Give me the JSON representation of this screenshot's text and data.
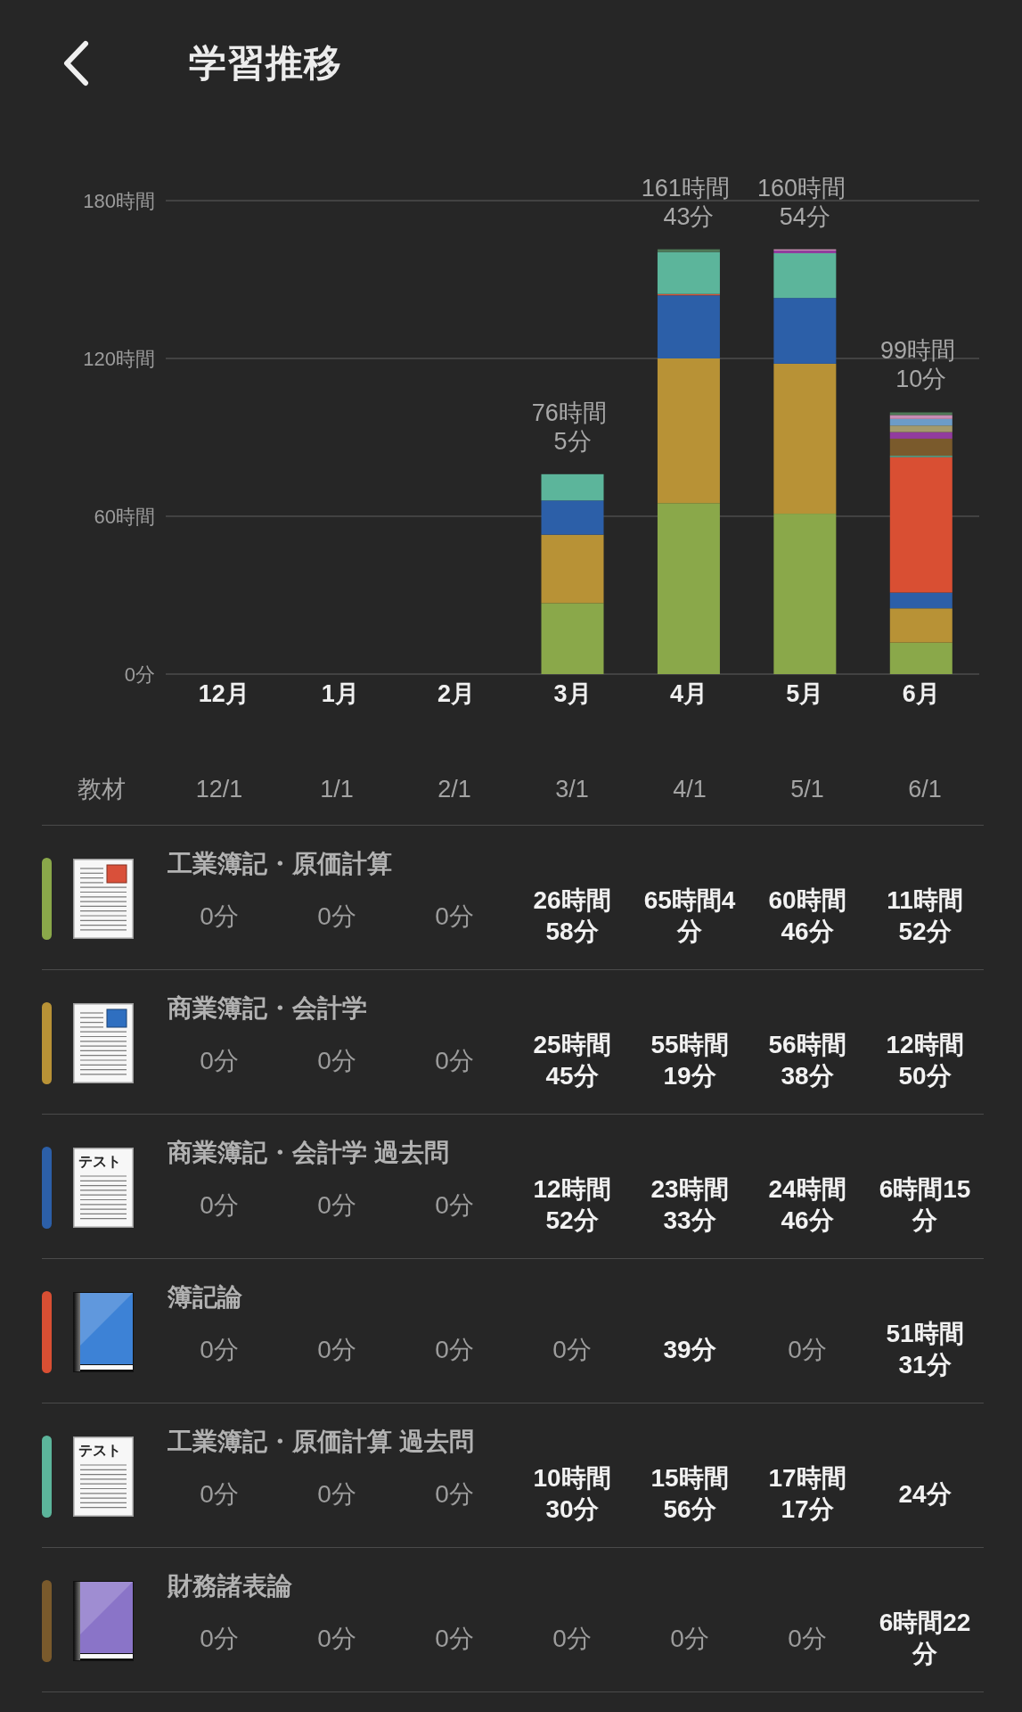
{
  "header": {
    "title": "学習推移"
  },
  "chart": {
    "chart_data": {
      "type": "bar",
      "stacked": true,
      "categories": [
        "12月",
        "1月",
        "2月",
        "3月",
        "4月",
        "5月",
        "6月"
      ],
      "ylim": [
        0,
        180
      ],
      "yticks": [
        {
          "value": 0,
          "label": "0分"
        },
        {
          "value": 60,
          "label": "60時間"
        },
        {
          "value": 120,
          "label": "120時間"
        },
        {
          "value": 180,
          "label": "180時間"
        }
      ],
      "series": [
        {
          "color": "#8aa84a",
          "values": [
            0,
            0,
            0,
            27,
            65,
            61,
            12
          ]
        },
        {
          "color": "#b89236",
          "values": [
            0,
            0,
            0,
            26,
            55,
            57,
            13
          ]
        },
        {
          "color": "#2c5fa8",
          "values": [
            0,
            0,
            0,
            13,
            24,
            25,
            6
          ]
        },
        {
          "color": "#d94f33",
          "values": [
            0,
            0,
            0,
            0,
            0.5,
            0,
            51.5
          ]
        },
        {
          "color": "#5cb59b",
          "values": [
            0,
            0,
            0,
            10,
            16,
            17,
            0.5
          ]
        },
        {
          "color": "#7a5a2c",
          "values": [
            0,
            0,
            0,
            0,
            0,
            0,
            6.5
          ]
        },
        {
          "color": "#923c9e",
          "values": [
            0,
            0,
            0,
            0,
            0,
            1,
            2.5
          ]
        },
        {
          "color": "#a39a6c",
          "values": [
            0,
            0,
            0,
            0,
            0,
            0,
            2.5
          ]
        },
        {
          "color": "#6c9cc8",
          "values": [
            0,
            0,
            0,
            0,
            0,
            0,
            2.5
          ]
        },
        {
          "color": "#c88db4",
          "values": [
            0,
            0,
            0,
            0,
            0,
            0.5,
            1.5
          ]
        },
        {
          "color": "#4f7a58",
          "values": [
            0,
            0,
            0,
            0,
            1,
            0,
            1
          ]
        }
      ],
      "value_labels": [
        null,
        null,
        null,
        "76時間\n5分",
        "161時間\n43分",
        "160時間\n54分",
        "99時間\n10分"
      ]
    }
  },
  "table": {
    "columns": [
      "教材",
      "12/1",
      "1/1",
      "2/1",
      "3/1",
      "4/1",
      "5/1",
      "6/1"
    ],
    "rows": [
      {
        "color": "#8aa84a",
        "icon": {
          "kind": "document",
          "color": "#d9503a"
        },
        "title": "工業簿記・原価計算",
        "values": [
          {
            "text": "0分",
            "emphasized": false
          },
          {
            "text": "0分",
            "emphasized": false
          },
          {
            "text": "0分",
            "emphasized": false
          },
          {
            "text": "26時間\n58分",
            "emphasized": true
          },
          {
            "text": "65時間4\n分",
            "emphasized": true
          },
          {
            "text": "60時間\n46分",
            "emphasized": true
          },
          {
            "text": "11時間\n52分",
            "emphasized": true
          }
        ]
      },
      {
        "color": "#b89236",
        "icon": {
          "kind": "document",
          "color": "#2f6fc0"
        },
        "title": "商業簿記・会計学",
        "values": [
          {
            "text": "0分",
            "emphasized": false
          },
          {
            "text": "0分",
            "emphasized": false
          },
          {
            "text": "0分",
            "emphasized": false
          },
          {
            "text": "25時間\n45分",
            "emphasized": true
          },
          {
            "text": "55時間\n19分",
            "emphasized": true
          },
          {
            "text": "56時間\n38分",
            "emphasized": true
          },
          {
            "text": "12時間\n50分",
            "emphasized": true
          }
        ]
      },
      {
        "color": "#2c5fa8",
        "icon": {
          "kind": "test",
          "label": "テスト"
        },
        "title": "商業簿記・会計学 過去問",
        "values": [
          {
            "text": "0分",
            "emphasized": false
          },
          {
            "text": "0分",
            "emphasized": false
          },
          {
            "text": "0分",
            "emphasized": false
          },
          {
            "text": "12時間\n52分",
            "emphasized": true
          },
          {
            "text": "23時間\n33分",
            "emphasized": true
          },
          {
            "text": "24時間\n46分",
            "emphasized": true
          },
          {
            "text": "6時間15\n分",
            "emphasized": true
          }
        ]
      },
      {
        "color": "#d94f33",
        "icon": {
          "kind": "book",
          "color": "#3d82d6"
        },
        "title": "簿記論",
        "values": [
          {
            "text": "0分",
            "emphasized": false
          },
          {
            "text": "0分",
            "emphasized": false
          },
          {
            "text": "0分",
            "emphasized": false
          },
          {
            "text": "0分",
            "emphasized": false
          },
          {
            "text": "39分",
            "emphasized": true
          },
          {
            "text": "0分",
            "emphasized": false
          },
          {
            "text": "51時間\n31分",
            "emphasized": true
          }
        ]
      },
      {
        "color": "#5cb59b",
        "icon": {
          "kind": "test",
          "label": "テスト"
        },
        "title": "工業簿記・原価計算 過去問",
        "values": [
          {
            "text": "0分",
            "emphasized": false
          },
          {
            "text": "0分",
            "emphasized": false
          },
          {
            "text": "0分",
            "emphasized": false
          },
          {
            "text": "10時間\n30分",
            "emphasized": true
          },
          {
            "text": "15時間\n56分",
            "emphasized": true
          },
          {
            "text": "17時間\n17分",
            "emphasized": true
          },
          {
            "text": "24分",
            "emphasized": true
          }
        ]
      },
      {
        "color": "#7a5a2c",
        "icon": {
          "kind": "book",
          "color": "#8a74c8"
        },
        "title": "財務諸表論",
        "values": [
          {
            "text": "0分",
            "emphasized": false
          },
          {
            "text": "0分",
            "emphasized": false
          },
          {
            "text": "0分",
            "emphasized": false
          },
          {
            "text": "0分",
            "emphasized": false
          },
          {
            "text": "0分",
            "emphasized": false
          },
          {
            "text": "0分",
            "emphasized": false
          },
          {
            "text": "6時間22\n分",
            "emphasized": true
          }
        ]
      }
    ]
  }
}
